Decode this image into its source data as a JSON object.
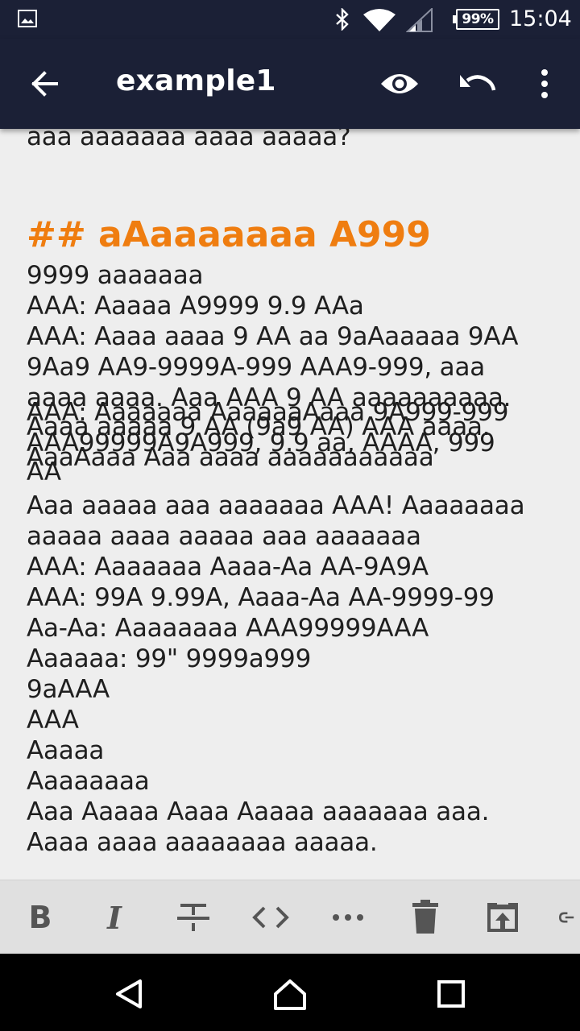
{
  "status_bar": {
    "battery": "99%",
    "time": "15:04",
    "icons": [
      "image-icon",
      "bluetooth-icon",
      "wifi-icon",
      "signal-icon",
      "battery-icon"
    ]
  },
  "app_bar": {
    "title": "example1",
    "icons": [
      "back-arrow-icon",
      "eye-icon",
      "undo-icon",
      "more-vert-icon"
    ]
  },
  "editor": {
    "top_cut_line": "aaa aaaaaaa aaaa aaaaa?",
    "heading": "## aAaaaaaaa A999",
    "lines": [
      "9999 aaaaaaa",
      "AAA: Aaaaa A9999 9.9 AAa",
      "AAA: Aaaa aaaa 9 AA aa 9aAaaaaa 9AA",
      "9Aa9 AA9-9999A-999 AAA9-999, aaa",
      "aaaa aaaa. Aaa AAA 9 AA aaaaaaaaaa.",
      "AAA: Aaaaaaa AaaaaaAaaa 9A999-999",
      "Aaaa aaaaa 9 AA (9a9 AA) AAA aaaa.",
      "AAA99999A9A999, 9.9 aa, AAAA, 999",
      "AaaAaaa Aaa aaaa aaaaaaaaaaa",
      "AA",
      "Aaa aaaaa aaa aaaaaaa AAA! Aaaaaaaa",
      "aaaaa aaaa aaaaa aaa aaaaaaa",
      "AAA: Aaaaaaa Aaaa-Aa AA-9A9A",
      "AAA: 99A 9.99A, Aaaa-Aa AA-9999-99",
      "Aa-Aa: Aaaaaaaa AAA99999AAA",
      "Aaaaaa: 99\" 9999a999",
      "9aAAA",
      "AAA",
      "Aaaaa",
      "Aaaaaaaa",
      "Aaa Aaaaa Aaaa Aaaaa aaaaaaa aaa.",
      "Aaaa aaaa aaaaaaaa aaaaa."
    ]
  },
  "format_toolbar": {
    "bold_label": "B",
    "italic_label": "I",
    "items": [
      "bold-icon",
      "italic-icon",
      "strikethrough-icon",
      "code-icon",
      "more-horiz-icon",
      "delete-icon",
      "open-external-icon",
      "link-icon"
    ]
  },
  "nav_bar": {
    "items": [
      "back-triangle-icon",
      "home-icon",
      "recents-icon"
    ]
  },
  "colors": {
    "app_bar": "#1b2036",
    "heading": "#ef7d10",
    "editor_bg": "#eeeeee",
    "toolbar_bg": "#e0e0e0",
    "text": "#1f1f1f"
  }
}
